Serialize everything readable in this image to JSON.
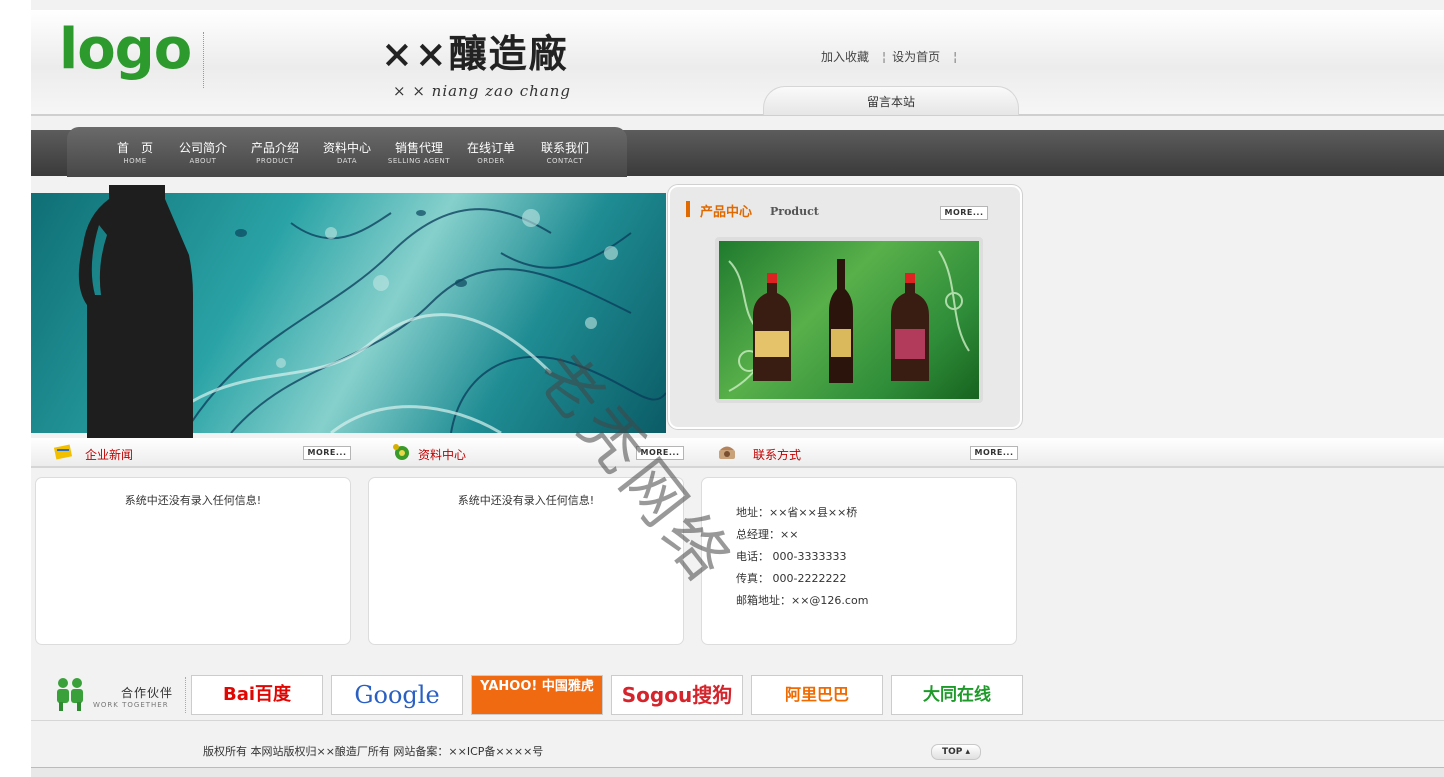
{
  "header": {
    "logo": "logo",
    "site_name_cn": "××釀造廠",
    "site_name_en": "× × niang zao chang",
    "links": [
      "加入收藏",
      "设为首页"
    ],
    "message_tab": "留言本站"
  },
  "nav": [
    {
      "cn": "首　页",
      "en": "HOME"
    },
    {
      "cn": "公司简介",
      "en": "ABOUT"
    },
    {
      "cn": "产品介绍",
      "en": "PRODUCT"
    },
    {
      "cn": "资料中心",
      "en": "DATA"
    },
    {
      "cn": "销售代理",
      "en": "SELLING AGENT"
    },
    {
      "cn": "在线订单",
      "en": "ORDER"
    },
    {
      "cn": "联系我们",
      "en": "CONTACT"
    }
  ],
  "product": {
    "title": "产品中心",
    "title_en": "Product",
    "more": "MORE..."
  },
  "sections": {
    "news": {
      "title": "企业新闻",
      "more": "MORE...",
      "empty": "系统中还没有录入任何信息!"
    },
    "data": {
      "title": "资料中心",
      "more": "MORE...",
      "empty": "系统中还没有录入任何信息!"
    },
    "contact": {
      "title": "联系方式",
      "more": "MORE...",
      "lines": [
        "地址：××省××县××桥",
        "总经理：××",
        "电话： 000-3333333",
        "传真： 000-2222222",
        "邮箱地址：××@126.com"
      ]
    }
  },
  "partners": {
    "label": "合作伙伴",
    "label_en": "WORK TOGETHER",
    "items": [
      "Bai百度",
      "Google",
      "YAHOO! 中国雅虎",
      "Sogou搜狗",
      "阿里巴巴",
      "大同在线"
    ]
  },
  "footer": {
    "copyright": "版权所有 本网站版权归××酿造厂所有 网站备案：××ICP备××××号",
    "top": "TOP"
  },
  "watermark": "老秃网络",
  "colors": {
    "logo_green": "#2c9a2c",
    "nav_bg": "#454545",
    "section_red": "#c00000",
    "product_orange": "#e06a00",
    "banner_teal": "#2aa3a6"
  }
}
